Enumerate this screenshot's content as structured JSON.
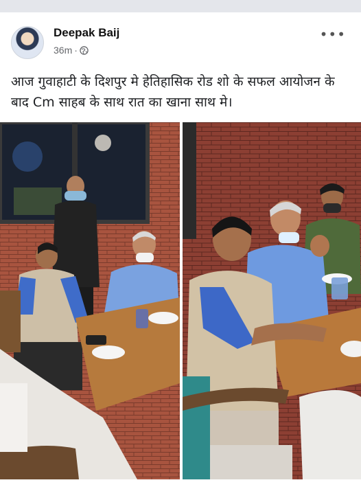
{
  "post": {
    "author": "Deepak Baij",
    "time": "36m",
    "separator": "·",
    "privacy_icon": "globe-icon",
    "more_icon": "more-options-icon",
    "more_label": "•••",
    "text": "आज गुवाहाटी के दिशपुर मे हेतिहासिक रोड शो के सफल आयोजन के बाद Cm साहब के साथ रात का खाना साथ मे।"
  },
  "photos": [
    {
      "name": "photo-left",
      "icon": "image"
    },
    {
      "name": "photo-right",
      "icon": "image"
    }
  ],
  "colors": {
    "topbar": "#e4e6eb",
    "meta_text": "#65676b",
    "name_text": "#111111"
  }
}
